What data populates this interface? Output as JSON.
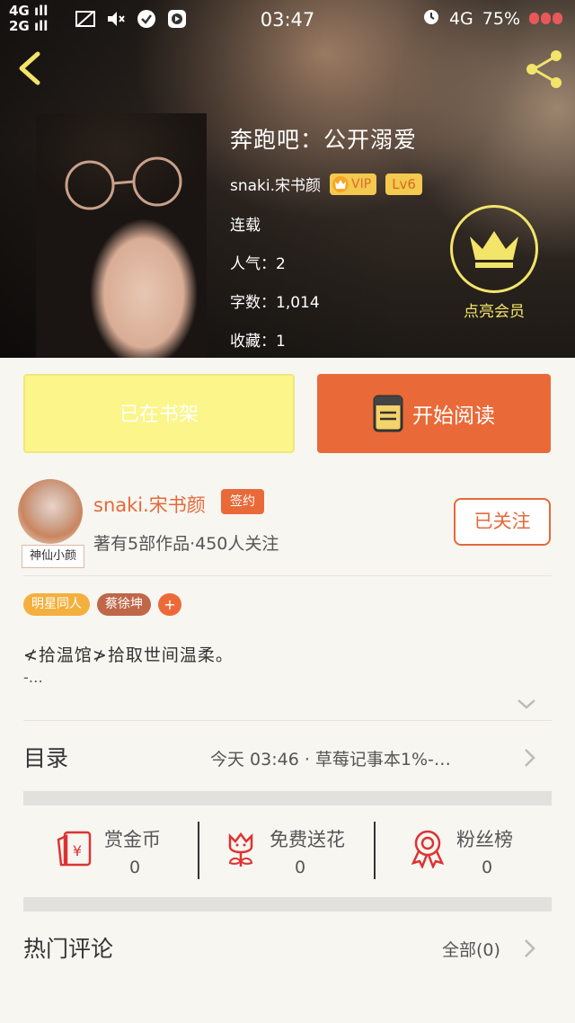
{
  "status_bar": {
    "network_top": "4G",
    "network_bottom": "2G",
    "time": "03:47",
    "right_network": "4G",
    "battery_percent": "75%"
  },
  "book": {
    "title": "奔跑吧：公开溺爱",
    "author": "snaki.宋书颜",
    "vip_label": "VIP",
    "level": "Lv6",
    "status": "连载",
    "popularity": "人气：2",
    "word_count": "字数：1,014",
    "favorites": "收藏：1"
  },
  "member": {
    "label": "点亮会员"
  },
  "actions": {
    "shelf_label": "已在书架",
    "read_label": "开始阅读"
  },
  "author": {
    "name": "snaki.宋书颜",
    "sign_badge": "签约",
    "avatar_tag": "神仙小颜",
    "stats": "著有5部作品·450人关注",
    "follow_label": "已关注"
  },
  "tags": [
    {
      "label": "明星同人"
    },
    {
      "label": "蔡徐坤"
    },
    {
      "label": "+"
    }
  ],
  "intro": {
    "text": "≮拾温馆≯拾取世间温柔。",
    "more": "-…"
  },
  "catalog": {
    "title": "目录",
    "update": "今天 03:46 · 草莓记事本1%-…"
  },
  "stats": [
    {
      "label": "赏金币",
      "value": "0",
      "icon": "reward-coin-icon"
    },
    {
      "label": "免费送花",
      "value": "0",
      "icon": "flower-icon"
    },
    {
      "label": "粉丝榜",
      "value": "0",
      "icon": "medal-icon"
    }
  ],
  "comments": {
    "title": "热门评论",
    "all_label": "全部(0)"
  },
  "colors": {
    "accent": "#e96a38",
    "shelf_yellow": "#fbf58a",
    "gold": "#f3e46a"
  }
}
